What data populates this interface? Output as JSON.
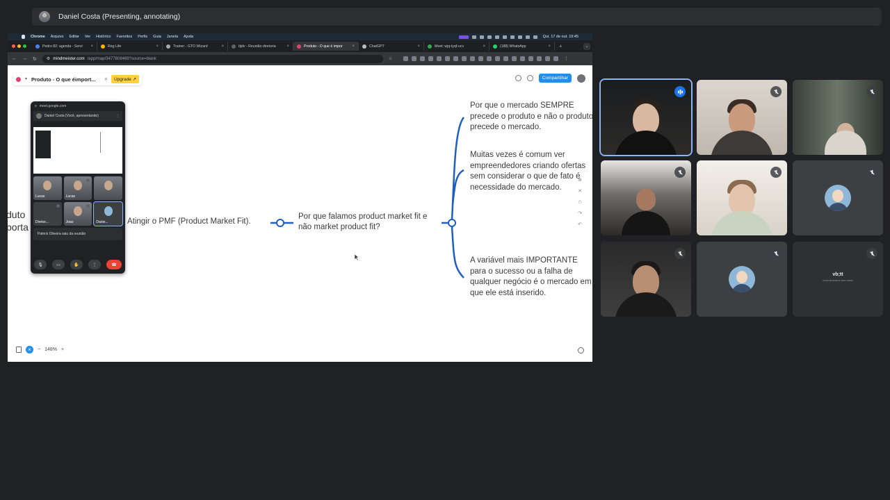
{
  "presenter": {
    "name": "Daniel Costa (Presenting, annotating)"
  },
  "mac_menu": {
    "items": [
      "Chrome",
      "Arquivo",
      "Editar",
      "Ver",
      "Histórico",
      "Favoritos",
      "Perfis",
      "Guia",
      "Janela",
      "Ajuda"
    ],
    "clock": "Qui. 17 de out. 19:45"
  },
  "browser": {
    "tabs": [
      {
        "title": "Pedro 82: agenda - Servi",
        "active": false
      },
      {
        "title": "Reg Life",
        "active": false
      },
      {
        "title": "Trainer - GTO Wizard",
        "active": false
      },
      {
        "title": "ttjdv - Reunião diretoria",
        "active": false
      },
      {
        "title": "Produto - O que é impor",
        "active": true
      },
      {
        "title": "ChatGPT",
        "active": false
      },
      {
        "title": "Meet: wjq-tyqf-ucv",
        "active": false
      },
      {
        "title": "(188) WhatsApp",
        "active": false
      }
    ],
    "url_host": "mindmeister.com",
    "url_path": "/app/map/3477808469?source=blank"
  },
  "mindmeister": {
    "map_title": "Produto - O que éimport...",
    "upgrade_label": "Upgrade ↗",
    "share_label": "Compartilhar",
    "zoom": "148%",
    "left_cut_text_1": "duto",
    "left_cut_text_2": "porta",
    "node_pmf": "Atingir o PMF (Product Market Fit).",
    "node_why": "Por que falamos product market fit e não market product fit?",
    "node_a": "Por que o mercado SEMPRE precede o produto e não o produto precede o mercado.",
    "node_b": "Muitas vezes é comum ver empreendedores criando ofertas sem considerar o que de fato é necessidade do mercado.",
    "node_c": "A variável mais IMPORTANTE para o sucesso ou a falha de qualquer negócio é o mercado em que ele está inserido."
  },
  "pip": {
    "url": "meet.google.com",
    "header": "Daniel Costa (Você, apresentando)",
    "tiles": [
      "Lucas",
      "Lucas",
      "",
      "Diretor...",
      "Joao",
      "Danie..."
    ],
    "notice": "Patrick Oliveira saiu da reunião"
  },
  "participants": {
    "logo_text": "vb;tt",
    "logo_sub": "VISÃO BUSINESS TECH TEAM"
  },
  "colors": {
    "accent": "#8ab4f8",
    "branch": "#1f5fbf",
    "end_call": "#ea4335"
  }
}
